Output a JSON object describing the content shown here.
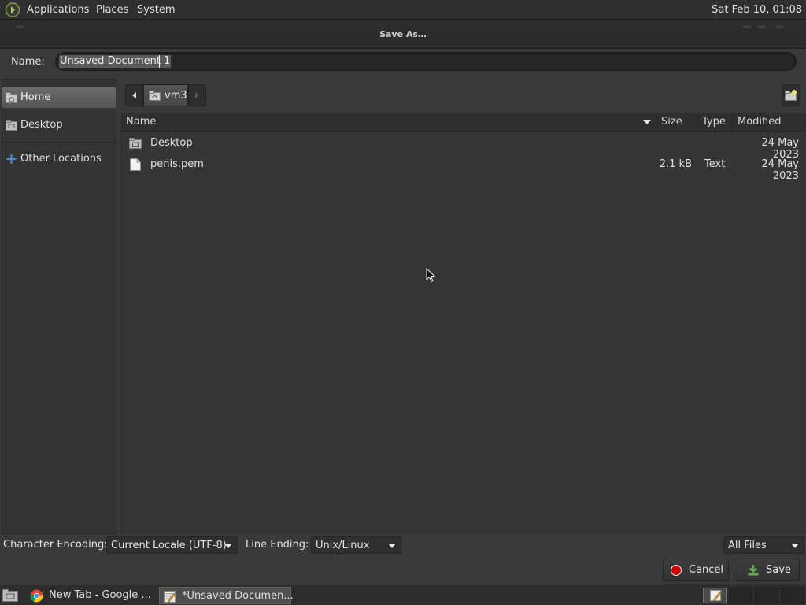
{
  "top_panel": {
    "menus": [
      "Applications",
      "Places",
      "System"
    ],
    "clock": "Sat Feb 10, 01:08"
  },
  "dialog": {
    "title": "Save As…",
    "name_label": "Name:",
    "name_value": "Unsaved Document 1"
  },
  "sidebar": {
    "items": [
      {
        "label": "Home",
        "icon": "home-folder-icon",
        "active": true
      },
      {
        "label": "Desktop",
        "icon": "desktop-folder-icon",
        "active": false
      },
      {
        "label": "Other Locations",
        "icon": "plus-icon",
        "active": false
      }
    ]
  },
  "path_bar": {
    "crumb": "vm3"
  },
  "file_list": {
    "columns": [
      "Name",
      "Size",
      "Type",
      "Modified"
    ],
    "rows": [
      {
        "name": "Desktop",
        "size": "",
        "type": "",
        "modified": "24 May 2023",
        "icon": "folder-icon"
      },
      {
        "name": "penis.pem",
        "size": "2.1 kB",
        "type": "Text",
        "modified": "24 May 2023",
        "icon": "text-file-icon"
      }
    ]
  },
  "options": {
    "encoding_label": "Character Encoding:",
    "encoding_value": "Current Locale (UTF-8)",
    "line_ending_label": "Line Ending:",
    "line_ending_value": "Unix/Linux",
    "filter_value": "All Files"
  },
  "buttons": {
    "cancel": "Cancel",
    "save": "Save"
  },
  "taskbar": {
    "tasks": [
      "New Tab - Google ...",
      "*Unsaved Documen..."
    ]
  },
  "colors": {
    "cancel_icon": "#d40000",
    "save_icon": "#6aa84f",
    "selection": "#5a5a5a"
  }
}
